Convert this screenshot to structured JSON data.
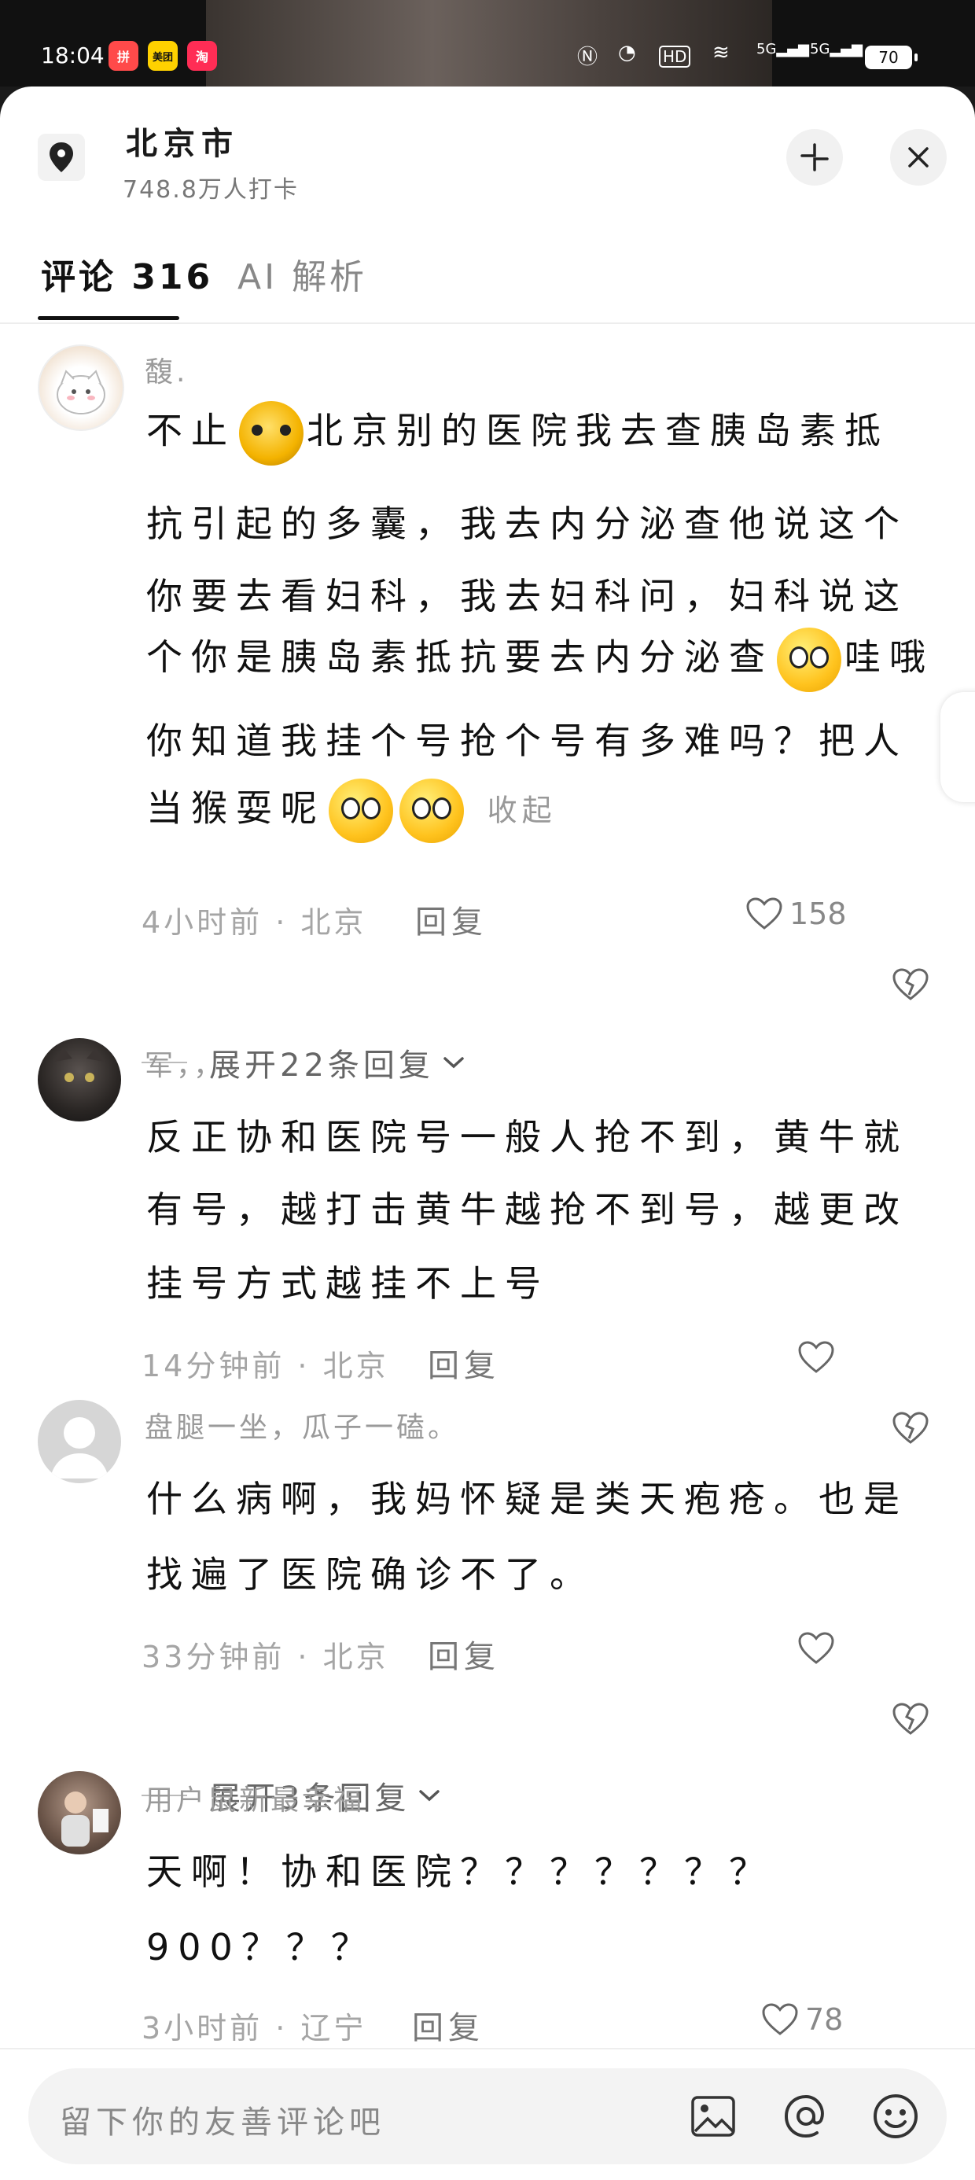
{
  "status_bar": {
    "time": "18:04",
    "apps": [
      "拼",
      "美团",
      "淘"
    ],
    "network": "5G",
    "battery": "70"
  },
  "header": {
    "location": "北京市",
    "checkins": "748.8万人打卡"
  },
  "tabs": [
    {
      "label": "评论 316"
    },
    {
      "label": "AI 解析"
    }
  ],
  "comments": [
    {
      "user": "馥.",
      "lines": [
        "北京别的医院我去查胰岛素抵",
        "抗引起的多囊，我去内分泌查他说这个",
        "你要去看妇科，我去妇科问，妇科说这",
        "个你是胰岛素抵抗要去内分泌查",
        "你知道我挂个号抢个号有多难吗？把人",
        "当猴耍呢"
      ],
      "prefix": "不止",
      "suffix_4": "哇哦",
      "collapse": "收起",
      "time": "4小时前 · 北京",
      "reply": "回复",
      "likes": "158",
      "expand": "展开22条回复"
    },
    {
      "user": "军，，",
      "lines": [
        "反正协和医院号一般人抢不到，黄牛就",
        "有号，越打击黄牛越抢不到号，越更改",
        "挂号方式越挂不上号"
      ],
      "time": "14分钟前 · 北京",
      "reply": "回复",
      "likes": ""
    },
    {
      "user": "盘腿一坐，瓜子一磕。",
      "lines": [
        "什么病啊，我妈怀疑是类天疱疮。也是",
        "找遍了医院确诊不了。"
      ],
      "time": "33分钟前 · 北京",
      "reply": "回复",
      "likes": "",
      "expand": "展开3条回复"
    },
    {
      "user": "用户鼠新最幸福",
      "lines": [
        "天啊！协和医院？？？？？？？",
        "900？？？"
      ],
      "time": "3小时前 · 辽宁",
      "reply": "回复",
      "likes": "78"
    }
  ],
  "input": {
    "placeholder": "留下你的友善评论吧"
  },
  "icons": [
    "location-pin-icon",
    "minimize-icon",
    "close-icon",
    "heart-icon",
    "broken-heart-icon",
    "chevron-down-icon",
    "image-icon",
    "at-icon",
    "emoji-icon"
  ]
}
